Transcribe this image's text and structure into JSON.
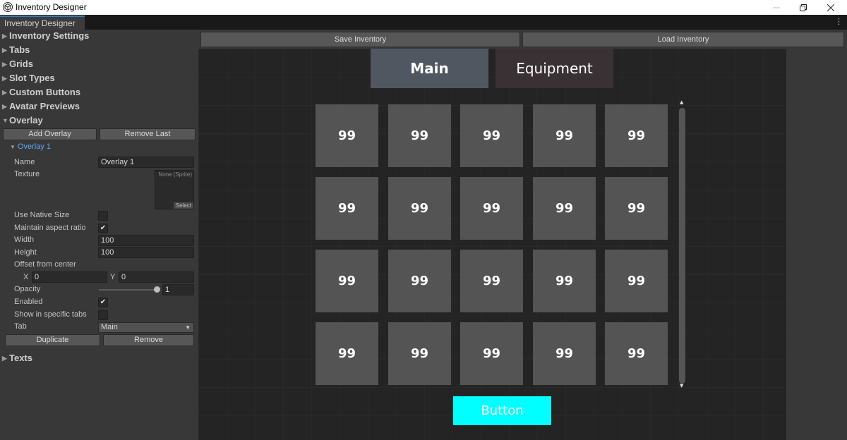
{
  "window": {
    "title": "Inventory Designer",
    "minimize_icon": "minimize-icon",
    "restore_icon": "restore-icon",
    "close_icon": "close-icon"
  },
  "editor_tab": {
    "label": "Inventory Designer",
    "menu_icon": "kebab-menu-icon"
  },
  "inspector": {
    "sections": {
      "inventory_settings": "Inventory Settings",
      "tabs": "Tabs",
      "grids": "Grids",
      "slot_types": "Slot Types",
      "custom_buttons": "Custom Buttons",
      "avatar_previews": "Avatar Previews",
      "overlay": "Overlay",
      "texts": "Texts"
    },
    "overlay": {
      "add_label": "Add Overlay",
      "remove_last_label": "Remove Last",
      "item_title": "Overlay 1",
      "name_label": "Name",
      "name_value": "Overlay 1",
      "texture_label": "Texture",
      "texture_value": "None (Sprite)",
      "texture_select": "Select",
      "native_size_label": "Use Native Size",
      "native_size_checked": false,
      "aspect_label": "Maintain aspect ratio",
      "aspect_checked": true,
      "width_label": "Width",
      "width_value": "100",
      "height_label": "Height",
      "height_value": "100",
      "offset_label": "Offset from center",
      "x_label": "X",
      "x_value": "0",
      "y_label": "Y",
      "y_value": "0",
      "opacity_label": "Opacity",
      "opacity_value": "1",
      "enabled_label": "Enabled",
      "enabled_checked": true,
      "specific_tabs_label": "Show in specific tabs",
      "specific_tabs_checked": false,
      "tab_label": "Tab",
      "tab_value": "Main",
      "duplicate_label": "Duplicate",
      "remove_label": "Remove",
      "check_mark": "✔"
    }
  },
  "toolbar": {
    "save_label": "Save Inventory",
    "load_label": "Load Inventory"
  },
  "preview": {
    "tabs": [
      {
        "label": "Main",
        "color": "#515761",
        "active": true
      },
      {
        "label": "Equipment",
        "color": "#3a3135",
        "active": false
      }
    ],
    "slot_color": "#545454",
    "slots": [
      "99",
      "99",
      "99",
      "99",
      "99",
      "99",
      "99",
      "99",
      "99",
      "99",
      "99",
      "99",
      "99",
      "99",
      "99",
      "99",
      "99",
      "99",
      "99",
      "99"
    ],
    "button_label": "Button",
    "button_color": "#00ffff"
  }
}
